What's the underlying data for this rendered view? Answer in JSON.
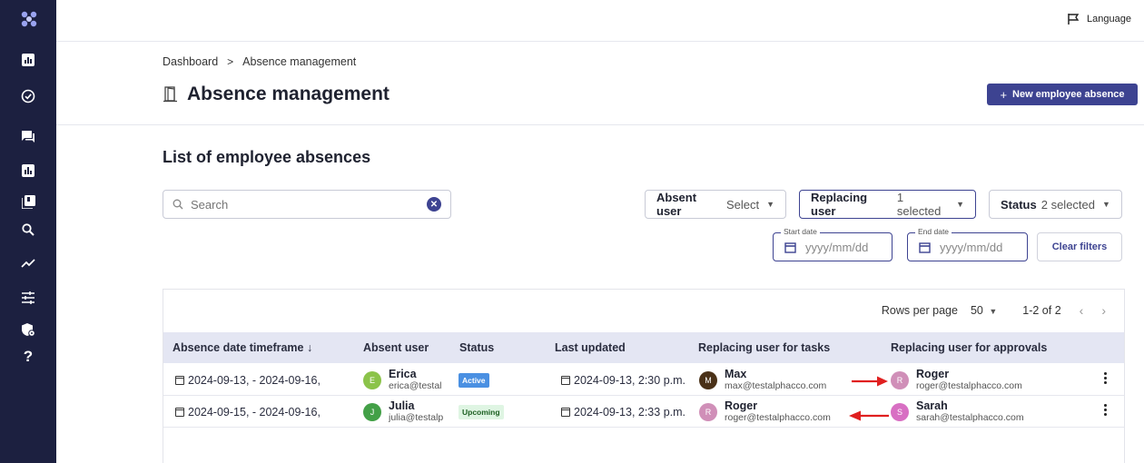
{
  "topbar": {
    "language_label": "Language"
  },
  "breadcrumb": {
    "home": "Dashboard",
    "separator": ">",
    "current": "Absence management"
  },
  "page": {
    "title": "Absence management",
    "new_button": "New employee absence",
    "new_button_icon": "+"
  },
  "section": {
    "title": "List of employee absences"
  },
  "search": {
    "placeholder": "Search"
  },
  "filters": {
    "absent_user": {
      "label": "Absent user",
      "value": "Select"
    },
    "replacing_user": {
      "label": "Replacing user",
      "value": "1 selected"
    },
    "status": {
      "label": "Status",
      "value": "2 selected"
    },
    "start_date": {
      "label": "Start date",
      "placeholder": "yyyy/mm/dd"
    },
    "end_date": {
      "label": "End date",
      "placeholder": "yyyy/mm/dd"
    },
    "clear": "Clear filters"
  },
  "pagination": {
    "rows_per_page_label": "Rows per page",
    "rows_per_page": "50",
    "range": "1-2 of 2"
  },
  "table": {
    "headers": [
      "Absence date timeframe",
      "Absent user",
      "Status",
      "Last updated",
      "Replacing user for tasks",
      "Replacing user for approvals"
    ],
    "sort_indicator": "↓",
    "rows": [
      {
        "timeframe": "2024-09-13, - 2024-09-16,",
        "absent": {
          "initial": "E",
          "name": "Erica",
          "email": "erica@testal"
        },
        "status": "Active",
        "last_updated": "2024-09-13, 2:30 p.m.",
        "tasks": {
          "initial": "M",
          "name": "Max",
          "email": "max@testalphacco.com"
        },
        "approvals": {
          "initial": "R",
          "name": "Roger",
          "email": "roger@testalphacco.com"
        }
      },
      {
        "timeframe": "2024-09-15, - 2024-09-16,",
        "absent": {
          "initial": "J",
          "name": "Julia",
          "email": "julia@testalp"
        },
        "status": "Upcoming",
        "last_updated": "2024-09-13, 2:33 p.m.",
        "tasks": {
          "initial": "R",
          "name": "Roger",
          "email": "roger@testalphacco.com"
        },
        "approvals": {
          "initial": "S",
          "name": "Sarah",
          "email": "sarah@testalphacco.com"
        }
      }
    ]
  },
  "colors": {
    "sidebar": "#1c2040",
    "primary": "#3d4391",
    "header_bg": "#e4e6f3",
    "active_badge": "#4a90e2",
    "upcoming_badge_bg": "#dff5e3",
    "avatar_erica": "#8bc34a",
    "avatar_julia": "#43a047",
    "avatar_max": "#4a3118",
    "avatar_roger": "#d08fb8",
    "avatar_sarah": "#d86fc3",
    "annotation_arrow": "#e02020"
  },
  "icons": {
    "sidebar": [
      "logo-icon",
      "dashboard-icon",
      "check-circle-icon",
      "chat-icon",
      "bar-chart-icon",
      "library-icon",
      "search-icon",
      "trending-icon",
      "tune-icon",
      "security-icon",
      "help-icon"
    ],
    "language": "flag-icon",
    "page": "door-icon"
  }
}
